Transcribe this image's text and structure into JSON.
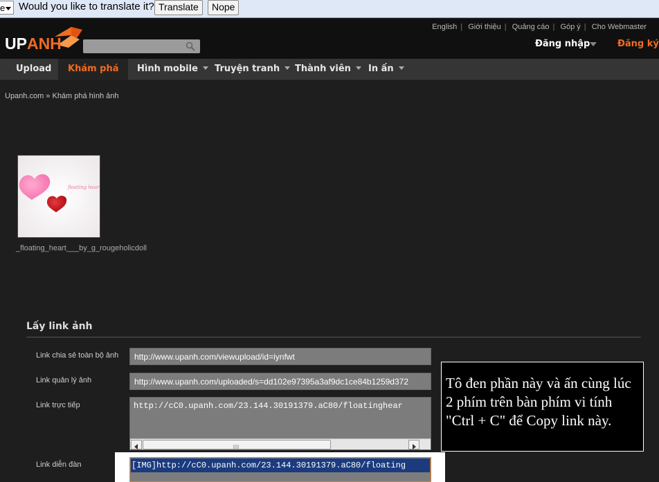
{
  "translate_bar": {
    "language_fragment": "e",
    "question": "Would you like to translate it?",
    "translate_label": "Translate",
    "nope_label": "Nope"
  },
  "header": {
    "logo_up": "UP",
    "logo_anh": "ANH",
    "search_placeholder": "",
    "toplinks": [
      "English",
      "Giới thiệu",
      "Quảng cáo",
      "Góp ý",
      "Cho Webmaster"
    ],
    "login_label": "Đăng nhập",
    "register_label": "Đăng ký"
  },
  "nav": {
    "items": [
      {
        "label": "Upload"
      },
      {
        "label": "Khám phá"
      },
      {
        "label": "Hình mobile"
      },
      {
        "label": "Truyện tranh"
      },
      {
        "label": "Thành viên"
      },
      {
        "label": "In ấn"
      }
    ]
  },
  "breadcrumb": "Upanh.com » Khám phá hình ảnh",
  "image": {
    "inner_text": "floating heart...",
    "caption": "_floating_heart___by_g_rougeholicdoll"
  },
  "links": {
    "heading": "Lấy link ảnh",
    "share_label": "Link chia sẻ toàn bộ ảnh",
    "share_value": "http://www.upanh.com/viewupload/id=iynfwt",
    "manage_label": "Link quản lý ảnh",
    "manage_value": "http://www.upanh.com/uploaded/s=dd102e97395a3af9dc1ce84b1259d372",
    "direct_label": "Link trực tiếp",
    "direct_value": "http://cC0.upanh.com/23.144.30191379.aC80/floatinghear",
    "forum_label": "Link diễn đàn",
    "forum_value": "[IMG]http://cC0.upanh.com/23.144.30191379.aC80/floating"
  },
  "callout": {
    "text": "Tô đen phần này và ấn cùng lúc 2 phím trên bàn phím vi tính \"Ctrl + C\" để Copy link này."
  },
  "colors": {
    "accent": "#f26b21",
    "background": "#1e1e1e",
    "selection": "#1b3b7e"
  }
}
